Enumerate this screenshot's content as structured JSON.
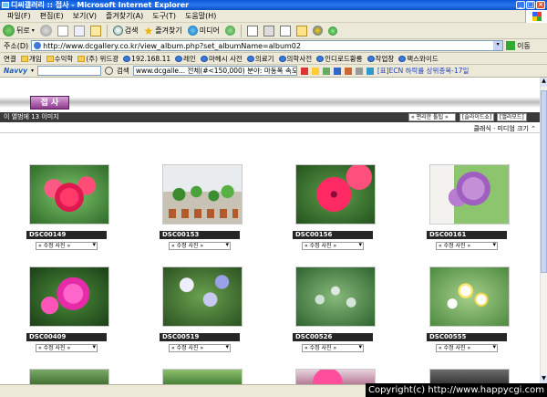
{
  "window": {
    "title": "디씨갤러리 :: 접사 - Microsoft Internet Explorer",
    "minimize": "_",
    "maximize": "□",
    "close": "×"
  },
  "menu": {
    "items": [
      "파일(F)",
      "편집(E)",
      "보기(V)",
      "즐겨찾기(A)",
      "도구(T)",
      "도움말(H)"
    ]
  },
  "toolbar": {
    "back": "뒤로",
    "search": "검색",
    "favorites": "즐겨찾기",
    "media": "미디어"
  },
  "address": {
    "label": "주소(D)",
    "url": "http://www.dcgallery.co.kr/view_album.php?set_albumName=album02",
    "go": "이동"
  },
  "links": {
    "label": "연결",
    "items": [
      "개임",
      "수익학",
      "(주) 위드광",
      "192.168.11",
      "레인",
      "마헤시 사전",
      "의료기",
      "의학사전",
      "인디로드황룡",
      "작업창",
      "팩스와이드"
    ]
  },
  "naver": {
    "brand": "Navvy",
    "search_label": "검색",
    "query": "www.dcgalle... 전체(#<150,000) 분야: 마동폭 속도(1.4)",
    "news": "[표]ECN 하락률 상위종목-17일"
  },
  "gallery": {
    "album_tab": "접 사",
    "info": "이 앨범에 13 이미지",
    "sort_select": "« 편리한 툴팁 »",
    "slideshow": "[슬라이드쇼]",
    "rebuild": "[앨라모드]",
    "size_links": "클래식 ·  미디엄 크기 ⌃",
    "thumbs": [
      {
        "name": "DSC00149",
        "edit": "« 수정 사진 »"
      },
      {
        "name": "DSC00153",
        "edit": "« 수정 사진 »"
      },
      {
        "name": "DSC00156",
        "edit": "« 수정 사진 »"
      },
      {
        "name": "DSC00161",
        "edit": "« 수정 사진 »"
      },
      {
        "name": "DSC00409",
        "edit": "« 수정 사진 »"
      },
      {
        "name": "DSC00519",
        "edit": "« 수정 사진 »"
      },
      {
        "name": "DSC00526",
        "edit": "« 수정 사진 »"
      },
      {
        "name": "DSC00555",
        "edit": "« 수정 사진 »"
      }
    ]
  },
  "status": {
    "text": ""
  },
  "watermark": "Copyright(c) http://www.happycgi.com"
}
